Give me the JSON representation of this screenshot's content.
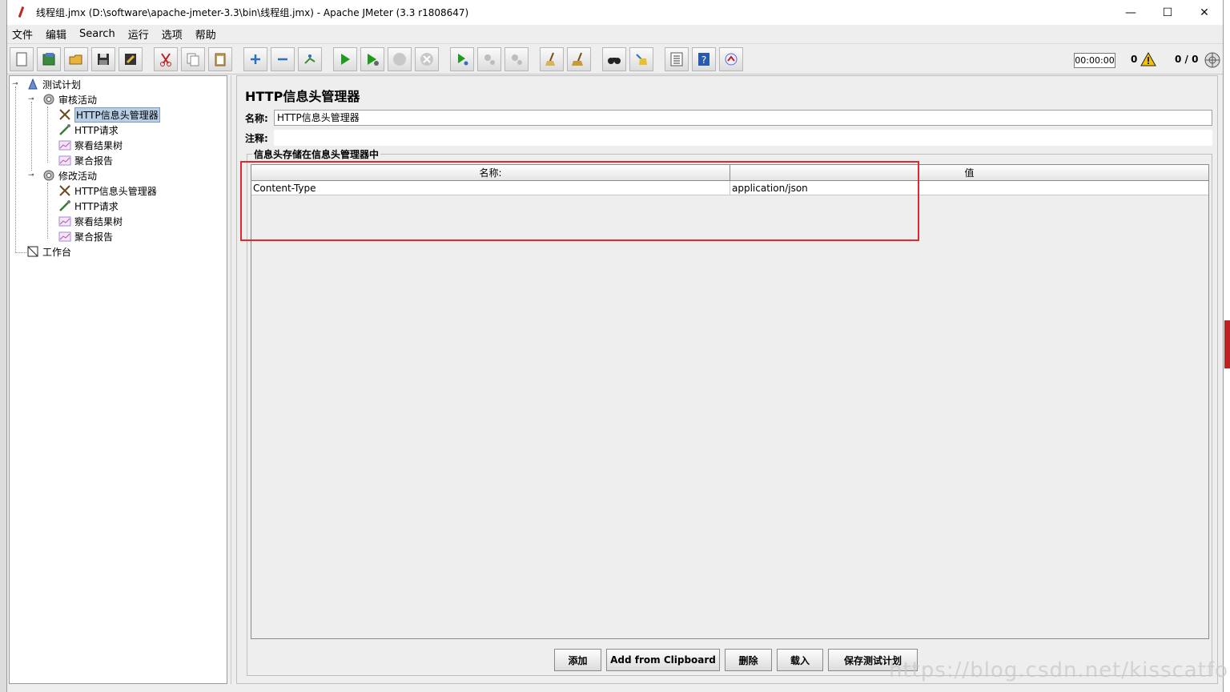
{
  "window": {
    "title": "线程组.jmx (D:\\software\\apache-jmeter-3.3\\bin\\线程组.jmx) - Apache JMeter (3.3 r1808647)",
    "minimize": "—",
    "maximize": "☐",
    "close": "✕"
  },
  "menu": [
    "文件",
    "编辑",
    "Search",
    "运行",
    "选项",
    "帮助"
  ],
  "toolbar": {
    "timer": "00:00:00",
    "warning_count": "0",
    "threads": "0 / 0",
    "icons": [
      "new-icon",
      "templates-icon",
      "open-icon",
      "save-icon",
      "save-as-icon",
      "cut-icon",
      "copy-icon",
      "paste-icon",
      "expand-icon",
      "collapse-icon",
      "toggle-icon",
      "start-icon",
      "start-no-pause-icon",
      "stop-icon",
      "shutdown-icon",
      "remote-start-icon",
      "remote-stop-icon",
      "remote-shutdown-icon",
      "clear-icon",
      "clear-all-icon",
      "search-icon",
      "reset-search-icon",
      "function-helper-icon",
      "help-icon",
      "logger-icon"
    ]
  },
  "tree": {
    "items": [
      {
        "label": "测试计划",
        "icon": "test-plan-icon"
      },
      {
        "label": "审核活动",
        "icon": "thread-group-icon"
      },
      {
        "label": "HTTP信息头管理器",
        "icon": "header-manager-icon",
        "selected": true
      },
      {
        "label": "HTTP请求",
        "icon": "http-request-icon"
      },
      {
        "label": "察看结果树",
        "icon": "listener-icon"
      },
      {
        "label": "聚合报告",
        "icon": "listener-icon"
      },
      {
        "label": "修改活动",
        "icon": "thread-group-icon"
      },
      {
        "label": "HTTP信息头管理器",
        "icon": "header-manager-icon"
      },
      {
        "label": "HTTP请求",
        "icon": "http-request-icon"
      },
      {
        "label": "察看结果树",
        "icon": "listener-icon"
      },
      {
        "label": "聚合报告",
        "icon": "listener-icon"
      },
      {
        "label": "工作台",
        "icon": "workbench-icon"
      }
    ]
  },
  "panel": {
    "title": "HTTP信息头管理器",
    "name_label": "名称:",
    "name_value": "HTTP信息头管理器",
    "comment_label": "注释:",
    "comment_value": "",
    "group_title": "信息头存储在信息头管理器中",
    "table": {
      "headers": [
        "名称:",
        "值"
      ],
      "rows": [
        [
          "Content-Type",
          "application/json"
        ]
      ]
    },
    "buttons": {
      "add": "添加",
      "clipboard": "Add from Clipboard",
      "delete": "删除",
      "load": "载入",
      "save": "保存测试计划"
    }
  },
  "watermark": "https://blog.csdn.net/kisscatforever"
}
